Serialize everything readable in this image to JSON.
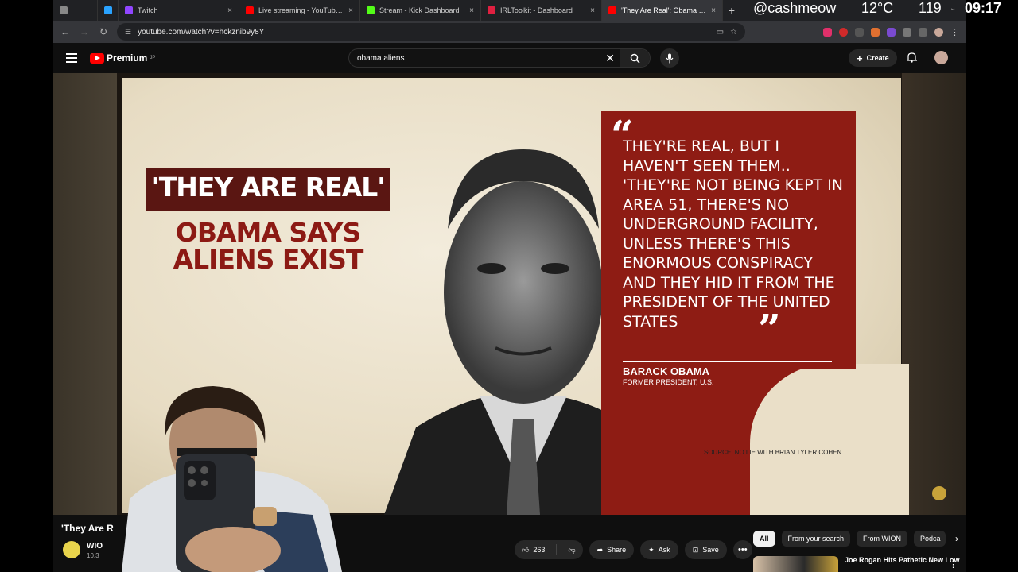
{
  "browser": {
    "tabs": [
      {
        "label": "",
        "color": "#888888",
        "active": false
      },
      {
        "label": "",
        "color": "#2aa3ff",
        "active": false
      },
      {
        "label": "Twitch",
        "color": "#9146ff",
        "active": false
      },
      {
        "label": "Live streaming - YouTube Stu",
        "color": "#ff0000",
        "active": false
      },
      {
        "label": "Stream - Kick Dashboard",
        "color": "#53fc18",
        "active": false
      },
      {
        "label": "IRLToolkit - Dashboard",
        "color": "#e02040",
        "active": false
      },
      {
        "label": "'They Are Real': Obama Says",
        "color": "#ff0000",
        "active": true
      }
    ],
    "new_tab": "+",
    "url": "youtube.com/watch?v=hckznib9y8Y"
  },
  "youtube": {
    "logo_text": "Premium",
    "logo_sup": "JP",
    "search_value": "obama aliens",
    "create_label": "Create"
  },
  "video_frame": {
    "headline": "'THEY ARE REAL'",
    "subhead": "OBAMA SAYS ALIENS EXIST",
    "quote": "THEY'RE REAL, BUT I HAVEN'T SEEN THEM.. 'THEY'RE NOT BEING KEPT IN AREA 51, THERE'S NO UNDERGROUND FACILITY, UNLESS THERE'S THIS ENORMOUS CONSPIRACY AND THEY HID IT FROM THE PRESIDENT OF THE UNITED STATES",
    "attribution_name": "BARACK OBAMA",
    "attribution_title": "FORMER PRESIDENT, U.S.",
    "source": "SOURCE: NO LIE WITH BRIAN TYLER COHEN"
  },
  "video_info": {
    "title": "'They Are R",
    "channel": "WIO",
    "subs": "10.3",
    "likes": "263",
    "share_label": "Share",
    "ask_label": "Ask",
    "save_label": "Save"
  },
  "chips": {
    "items": [
      "All",
      "From your search",
      "From WION",
      "Podca"
    ]
  },
  "recommendation": {
    "title": "Joe Rogan Hits Pathetic New Low"
  },
  "stream_overlay": {
    "handle": "@cashmeow",
    "temperature": "12°C",
    "count": "119",
    "time": "09:17"
  }
}
